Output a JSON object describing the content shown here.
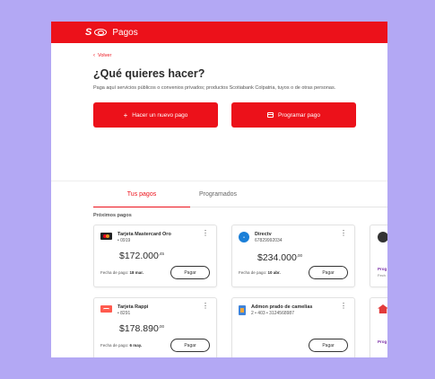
{
  "header": {
    "brand_glyph": "S",
    "title": "Pagos"
  },
  "hero": {
    "back_label": "Volver",
    "heading": "¿Qué quieres hacer?",
    "subtitle": "Paga aquí servicios públicos o convenios privados; productos Scotiabank Colpatria, tuyos o de otras personas.",
    "new_payment_label": "Hacer un nuevo pago",
    "schedule_label": "Programar pago"
  },
  "tabs": [
    {
      "label": "Tus pagos",
      "active": true
    },
    {
      "label": "Programados",
      "active": false
    }
  ],
  "section_label": "Próximos pagos",
  "due_prefix": "Fecha de pago:",
  "pay_label": "Pagar",
  "cards": [
    {
      "name": "Tarjeta Mastercard Oro",
      "detail": "• 0919",
      "amount": "$172.000",
      "cents": ",45",
      "due": "18 mar.",
      "icon": "mastercard-icon"
    },
    {
      "name": "Directv",
      "detail": "67829992034",
      "amount": "$234.000",
      "cents": ",00",
      "due": "10 abr.",
      "icon": "directv-icon"
    },
    {
      "name": "Tarjeta Rappi",
      "detail": "• 8291",
      "amount": "$178.890",
      "cents": ",00",
      "due": "6 may.",
      "icon": "rappi-card-icon"
    },
    {
      "name": "Admon prado de camelias",
      "detail": "2 • 403 • 3124568987",
      "amount": "",
      "cents": "",
      "due": "",
      "icon": "building-icon"
    }
  ],
  "peek": {
    "line1": "Prog",
    "line2": "Fech",
    "line3": "Prog"
  },
  "colors": {
    "brand_red": "#ec111a",
    "background": "#b3a8f4"
  }
}
